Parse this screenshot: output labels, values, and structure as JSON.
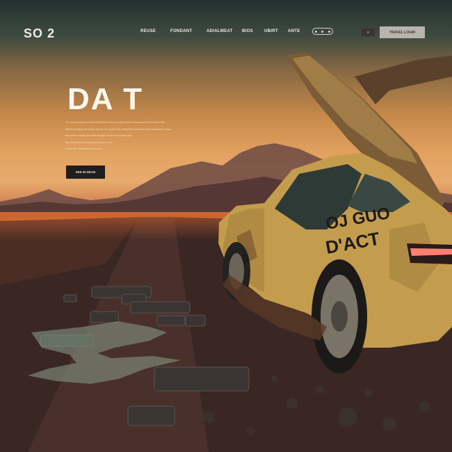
{
  "brand": {
    "logo": "SO 2"
  },
  "nav": {
    "links": [
      "REUSE",
      "FONDANT",
      "ADIALMEAT",
      "BIOS",
      "UBIRT",
      "ANTE"
    ]
  },
  "header_actions": {
    "menu_icon": "three-dots-icon",
    "lang_label": "≡",
    "cta_label": "TRAVEL LOGIN"
  },
  "hero": {
    "title": "DA T",
    "copy": [
      "The curious road and desert behind the dust, our cockpit frame reaching out for the horizon line.",
      "Wheels grinding over broken ground, the engine tells a story told a thousand miles away before dawn.",
      "Beyond the asphalt we chase the light, to the last mountain stop.",
      "Stay ahead of the journey and find your route.",
      "Explore the weathered roads now."
    ],
    "button_label": "SEE IN DEAD"
  },
  "car": {
    "livery_line1": "OJ GUO",
    "livery_line2": "D'ACT"
  },
  "colors": {
    "sky_top": "#24302f",
    "sky_glow": "#e8ab6d",
    "ground": "#2b1f1f",
    "car_body": "#c9a251"
  }
}
